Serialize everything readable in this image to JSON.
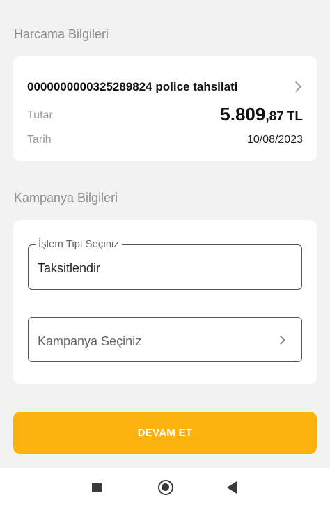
{
  "expense": {
    "section_title": "Harcama Bilgileri",
    "title": "0000000000325289824 police tahsilati",
    "amount_label": "Tutar",
    "amount_main": "5.809",
    "amount_decimal": ",87",
    "amount_currency": "TL",
    "date_label": "Tarih",
    "date_value": "10/08/2023"
  },
  "campaign": {
    "section_title": "Kampanya Bilgileri",
    "transaction_type_label": "İşlem Tipi Seçiniz",
    "transaction_type_value": "Taksitlendir",
    "campaign_placeholder": "Kampanya Seçiniz"
  },
  "actions": {
    "continue_label": "DEVAM ET"
  },
  "colors": {
    "background": "#f2f2f2",
    "primary_button": "#fbb20c",
    "card": "#ffffff"
  },
  "icons": {
    "expense_chevron": "chevron-right-icon",
    "campaign_chevron": "chevron-right-icon",
    "nav_recent": "square-icon",
    "nav_home": "circle-icon",
    "nav_back": "triangle-back-icon"
  }
}
